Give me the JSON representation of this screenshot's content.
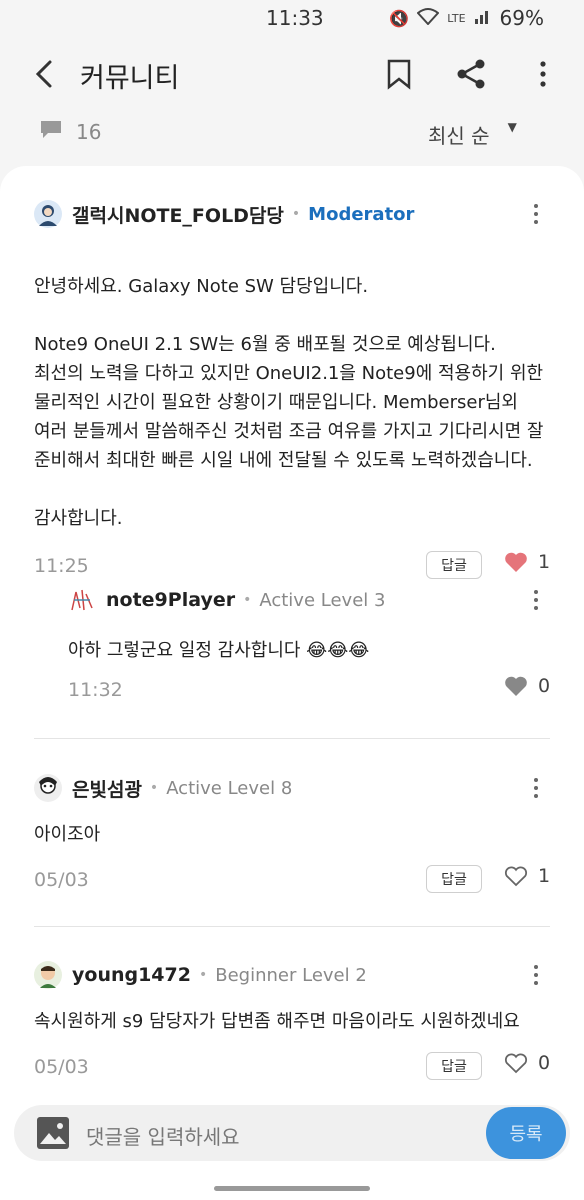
{
  "status_bar": {
    "time": "11:33",
    "network": "LTE",
    "battery": "69%"
  },
  "header": {
    "title": "커뮤니티"
  },
  "sort_bar": {
    "comment_count": "16",
    "sort_label": "최신 순"
  },
  "post": {
    "author": "갤럭시NOTE_FOLD담당",
    "level": "Moderator",
    "greeting": "안녕하세요. Galaxy Note SW 담당입니다.",
    "paragraph": "Note9 OneUI 2.1 SW는 6월 중 배포될 것으로 예상됩니다.\n최선의 노력을 다하고 있지만 OneUI2.1을 Note9에 적용하기 위한\n물리적인 시간이 필요한 상황이기 때문입니다. Memberser님외\n여러 분들께서 말씀해주신 것처럼 조금 여유를 가지고 기다리시면 잘\n준비해서 최대한 빠른 시일 내에 전달될 수 있도록 노력하겠습니다.",
    "closing": "감사합니다.",
    "time": "11:25",
    "reply_label": "답글",
    "likes": "1",
    "like_color": "#e5747a"
  },
  "reply": {
    "author": "note9Player",
    "level": "Active Level 3",
    "text": "아하 그렇군요 일정 감사합니다 😂😂😂",
    "time": "11:32",
    "likes": "0"
  },
  "comments": [
    {
      "author": "은빛섬광",
      "level": "Active Level 8",
      "text": "아이조아",
      "date": "05/03",
      "reply_label": "답글",
      "likes": "1"
    },
    {
      "author": "young1472",
      "level": "Beginner Level 2",
      "text": "속시원하게 s9 담당자가 답변좀 해주면 마음이라도 시원하겠네요",
      "date": "05/03",
      "reply_label": "답글",
      "likes": "0"
    }
  ],
  "composer": {
    "placeholder": "댓글을 입력하세요",
    "submit_label": "등록",
    "accent_color": "#3d93dd"
  }
}
